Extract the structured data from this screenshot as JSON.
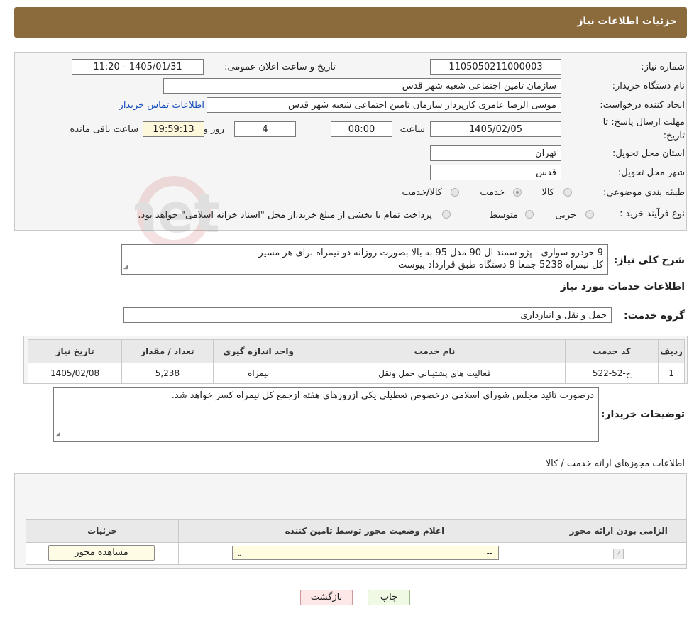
{
  "header": {
    "title": "جزئیات اطلاعات نیاز"
  },
  "form": {
    "need_number": {
      "label": "شماره نیاز:",
      "value": "1105050211000003"
    },
    "announce": {
      "label": "تاریخ و ساعت اعلان عمومی:",
      "value": "1405/01/31 - 11:20"
    },
    "buyer_org": {
      "label": "نام دستگاه خریدار:",
      "value": "سازمان تامین اجتماعی شعبه شهر قدس"
    },
    "creator": {
      "label": "ایجاد کننده درخواست:",
      "value": "موسی الرضا  عامری کارپرداز سازمان تامین اجتماعی شعبه شهر قدس"
    },
    "contact_link": "اطلاعات تماس خریدار",
    "deadline": {
      "label_line1": "مهلت ارسال پاسخ: تا",
      "label_line2": "تاریخ:",
      "date": "1405/02/05",
      "time_label": "ساعت",
      "time": "08:00",
      "days": "4",
      "days_label": "روز و",
      "remaining": "19:59:13",
      "remaining_label": "ساعت باقی مانده"
    },
    "province": {
      "label": "استان محل تحویل:",
      "value": "تهران"
    },
    "city": {
      "label": "شهر محل تحویل:",
      "value": "قدس"
    },
    "category": {
      "label": "طبقه بندی موضوعی:",
      "options": [
        "کالا",
        "خدمت",
        "کالا/خدمت"
      ],
      "selected": "خدمت"
    },
    "process": {
      "label": "نوع فرآیند خرید :",
      "options": [
        "جزیی",
        "متوسط"
      ],
      "note": "پرداخت تمام یا بخشی از مبلغ خرید،از محل \"اسناد خزانه اسلامی\" خواهد بود."
    },
    "summary": {
      "label": "شرح کلی نیاز:",
      "line1": "9 خودرو سواری - پژو سمند ال 90 مدل 95 به بالا بصورت روزانه دو نیمراه برای هر مسیر",
      "line2": "کل نیمراه 5238 جمعا 9 دستگاه طبق قرارداد پیوست"
    }
  },
  "services": {
    "section_title": "اطلاعات خدمات مورد نیاز",
    "group_label": "گروه خدمت:",
    "group_value": "حمل و نقل و انبارداری",
    "columns": [
      "ردیف",
      "کد خدمت",
      "نام خدمت",
      "واحد اندازه گیری",
      "تعداد / مقدار",
      "تاریخ نیاز"
    ],
    "rows": [
      [
        "1",
        "ح-52-522",
        "فعالیت های پشتیبانی حمل ونقل",
        "نیمراه",
        "5,238",
        "1405/02/08"
      ]
    ]
  },
  "buyer_notes": {
    "label": "توضیحات خریدار:",
    "text": "درصورت تائید مجلس شورای اسلامی درخصوص تعطیلی یکی ازروزهای هفته ازجمع کل نیمراه کسر خواهد شد."
  },
  "licenses": {
    "section_title": "اطلاعات مجوزهای ارائه خدمت / کالا",
    "columns": [
      "الزامی بودن ارائه مجوز",
      "اعلام وضعیت مجوز توسط تامین کننده",
      "جزئیات"
    ],
    "row": {
      "select_value": "--",
      "view_label": "مشاهده مجوز"
    }
  },
  "buttons": {
    "print": "چاپ",
    "back": "بازگشت"
  },
  "watermark": {
    "text": "AriaTender.net"
  }
}
